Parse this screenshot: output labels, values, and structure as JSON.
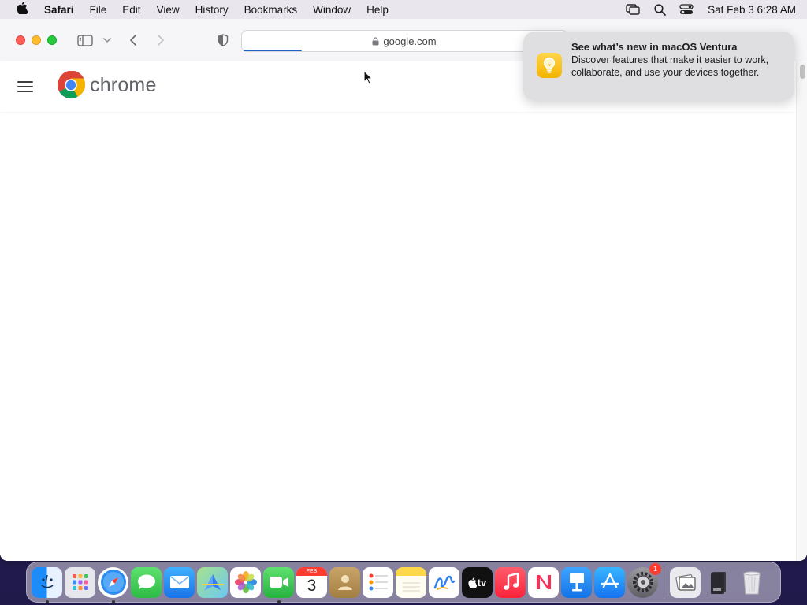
{
  "menubar": {
    "app_name": "Safari",
    "items": [
      "File",
      "Edit",
      "View",
      "History",
      "Bookmarks",
      "Window",
      "Help"
    ],
    "clock": "Sat Feb 3  6:28 AM"
  },
  "browser": {
    "address": "google.com",
    "load_progress": 0.18
  },
  "page": {
    "logo_text": "chrome"
  },
  "notification": {
    "title": "See what’s new in macOS Ventura",
    "body": "Discover features that make it easier to work, collaborate, and use your devices together."
  },
  "dock": {
    "calendar_month": "FEB",
    "calendar_day": "3",
    "tv_label": "tv",
    "settings_badge": "1"
  },
  "colors": {
    "accent": "#1f62c9",
    "close": "#fe5f57",
    "minimize": "#febc2e",
    "maximize": "#28c840"
  }
}
